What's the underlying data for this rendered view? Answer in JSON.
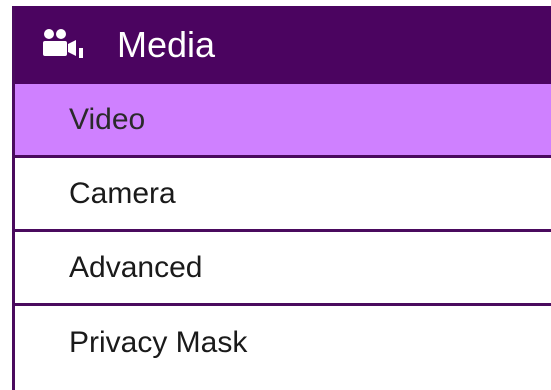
{
  "menu": {
    "header": {
      "icon": "media-camera-icon",
      "title": "Media"
    },
    "items": [
      {
        "label": "Video",
        "active": true
      },
      {
        "label": "Camera",
        "active": false
      },
      {
        "label": "Advanced",
        "active": false
      },
      {
        "label": "Privacy Mask",
        "active": false
      }
    ]
  },
  "colors": {
    "header_bg": "#4b0460",
    "active_bg": "#cf80ff",
    "border": "#4a0a5e"
  }
}
